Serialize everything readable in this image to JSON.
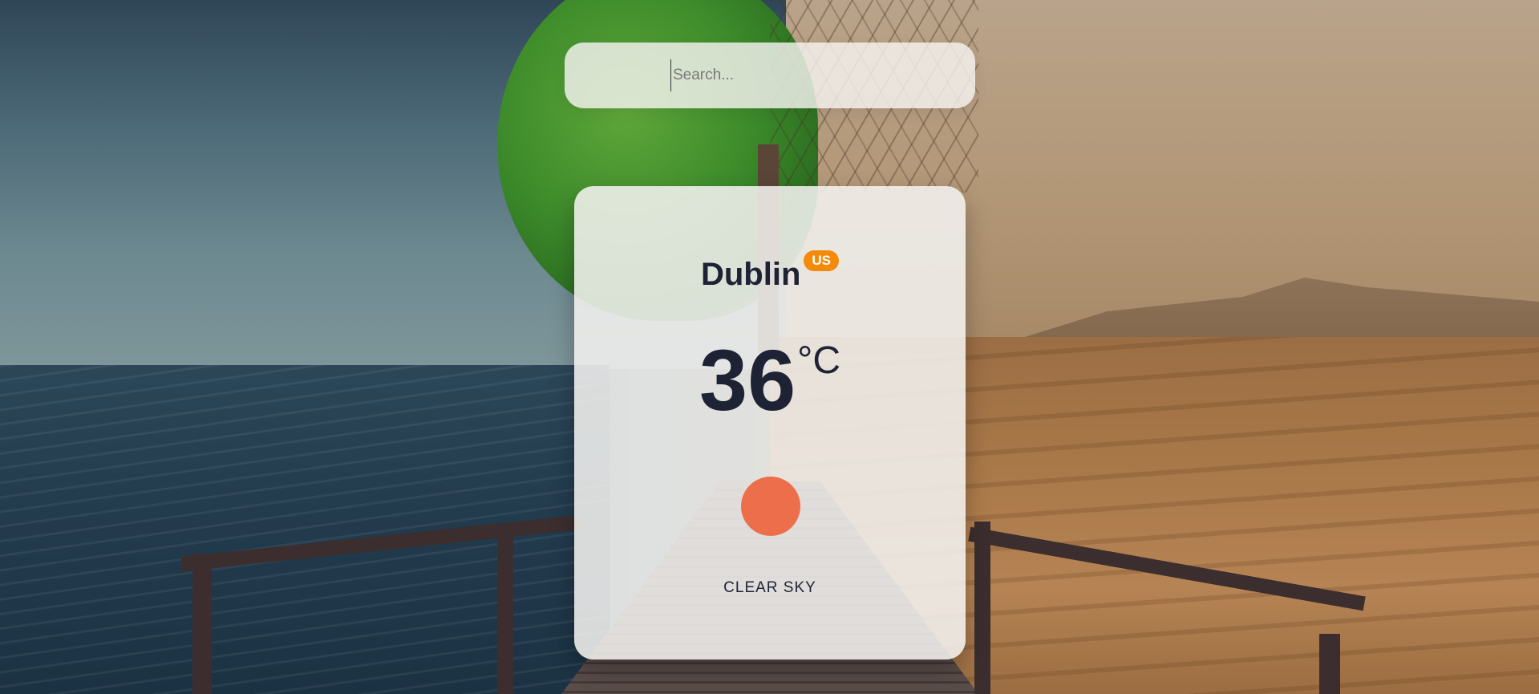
{
  "search": {
    "placeholder": "Search...",
    "value": ""
  },
  "weather": {
    "city": "Dublin",
    "country": "US",
    "temperature": "36",
    "unit": "°C",
    "description": "CLEAR SKY",
    "icon": "sun-icon"
  },
  "colors": {
    "badge": "#f48a0b",
    "sun": "#ec6e4b",
    "text": "#1e2235"
  }
}
